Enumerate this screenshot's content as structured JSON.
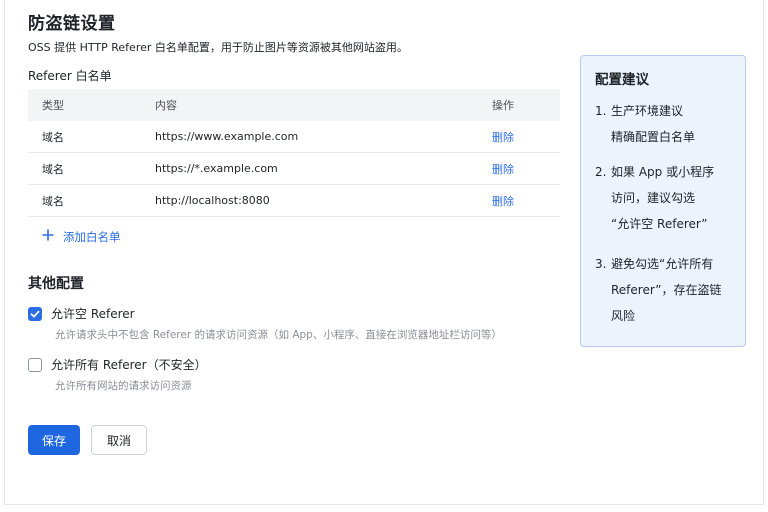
{
  "page": {
    "title": "防盗链设置",
    "description": "OSS 提供 HTTP Referer 白名单配置，用于防止图片等资源被其他网站盗用。"
  },
  "whitelist": {
    "section_label": "Referer 白名单",
    "columns": [
      "类型",
      "内容",
      "操作"
    ],
    "rows": [
      {
        "type": "域名",
        "content": "https://www.example.com",
        "action": "删除"
      },
      {
        "type": "域名",
        "content": "https://*.example.com",
        "action": "删除"
      },
      {
        "type": "域名",
        "content": "http://localhost:8080",
        "action": "删除"
      }
    ],
    "add_label": "添加白名单"
  },
  "other": {
    "title": "其他配置",
    "options": [
      {
        "label": "允许空 Referer",
        "hint": "允许请求头中不包含 Referer 的请求访问资源（如 App、小程序、直接在浏览器地址栏访问等）",
        "checked": true
      },
      {
        "label": "允许所有 Referer（不安全）",
        "hint": "允许所有网站的请求访问资源",
        "checked": false
      }
    ]
  },
  "actions": {
    "save": "保存",
    "cancel": "取消"
  },
  "tips": {
    "title": "配置建议",
    "items": [
      {
        "num": "1.",
        "line1": "生产环境建议",
        "line2": "精确配置白名单"
      },
      {
        "num": "2.",
        "line1": "如果 App 或小程序",
        "line2": "访问，建议勾选",
        "line3": "“允许空 Referer”"
      },
      {
        "num": "3.",
        "line1": "避免勾选“允许所有",
        "line2": "Referer”，存在盗链",
        "line3": "风险"
      }
    ]
  },
  "colors": {
    "accent": "#2b6de5",
    "primary_button": "#1f67e0",
    "tips_background": "#edf3fc",
    "tips_border": "#b6cdee"
  }
}
